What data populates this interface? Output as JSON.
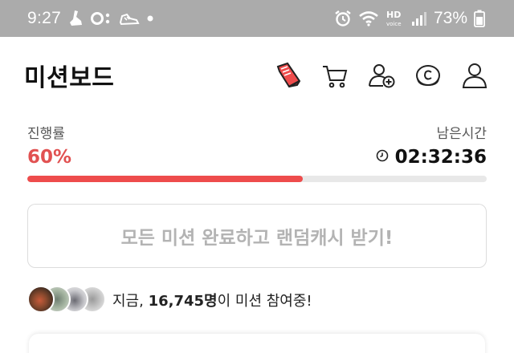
{
  "status_bar": {
    "time": "9:27",
    "battery": "73%",
    "icons_left": [
      "shoe-icon",
      "record-icon",
      "sneaker-icon",
      "dot-icon"
    ],
    "icons_right": [
      "alarm-icon",
      "wifi-icon",
      "hd-voice-icon",
      "signal-icon",
      "battery-icon"
    ]
  },
  "header": {
    "title": "미션보드",
    "icons": [
      "red-sneaker-icon",
      "cart-icon",
      "add-user-icon",
      "coin-c-icon",
      "profile-icon"
    ]
  },
  "progress": {
    "label": "진행률",
    "percent_text": "60%",
    "percent_value": 60,
    "time_label": "남은시간",
    "time_value": "02:32:36"
  },
  "cta": {
    "label": "모든 미션 완료하고 랜덤캐시 받기!"
  },
  "participants": {
    "prefix": "지금,",
    "count": "16,745명",
    "suffix": "이 미션 참여중!"
  },
  "colors": {
    "accent": "#ee4c4c",
    "status_bar_bg": "#ababab",
    "cta_text": "#b3b3b3"
  }
}
